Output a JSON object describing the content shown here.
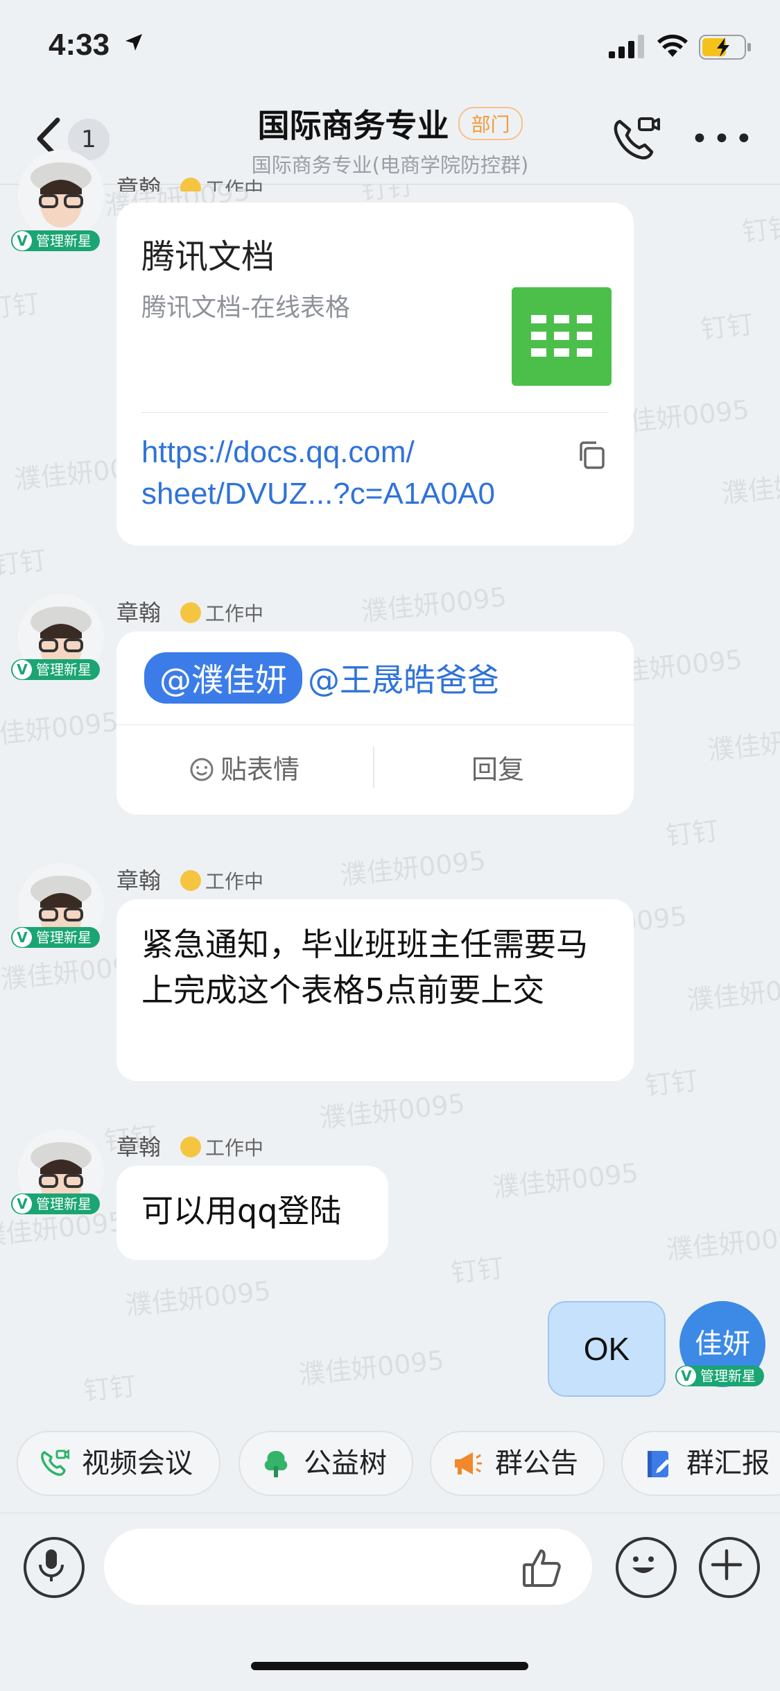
{
  "status_bar": {
    "time": "4:33"
  },
  "header": {
    "unread_count": "1",
    "title": "国际商务专业",
    "title_tag": "部门",
    "subtitle": "国际商务专业(电商学院防控群)"
  },
  "watermark": {
    "name": "濮佳妍0095",
    "app": "钉钉"
  },
  "messages": [
    {
      "sender": "章翰",
      "status": "工作中",
      "role_badge": "管理新星",
      "type": "doc_card",
      "doc_title": "腾讯文档",
      "doc_subtitle": "腾讯文档-在线表格",
      "link_line1": "https://docs.qq.com/",
      "link_line2": "sheet/DVUZ...?c=A1A0A0"
    },
    {
      "sender": "章翰",
      "status": "工作中",
      "role_badge": "管理新星",
      "type": "mention",
      "mention_self": "@濮佳妍",
      "mention_other": "@王晟皓爸爸",
      "action_react": "贴表情",
      "action_reply": "回复"
    },
    {
      "sender": "章翰",
      "status": "工作中",
      "role_badge": "管理新星",
      "type": "text",
      "text": "紧急通知，毕业班班主任需要马上完成这个表格5点前要上交"
    },
    {
      "sender": "章翰",
      "status": "工作中",
      "role_badge": "管理新星",
      "type": "text",
      "text": "可以用qq登陆"
    },
    {
      "sender_avatar_text": "佳妍",
      "role_badge": "管理新星",
      "type": "own_text",
      "text": "OK"
    }
  ],
  "quick_actions": [
    {
      "label": "视频会议",
      "icon": "video-meeting-icon",
      "color": "#2fb36b"
    },
    {
      "label": "公益树",
      "icon": "tree-icon",
      "color": "#34b36a"
    },
    {
      "label": "群公告",
      "icon": "megaphone-icon",
      "color": "#f0892c"
    },
    {
      "label": "群汇报",
      "icon": "report-icon",
      "color": "#3b7ce8"
    }
  ],
  "colors": {
    "accent": "#3b7ce8",
    "link": "#2f73d9",
    "badge": "#1aa573",
    "sheet": "#4cbf4b"
  }
}
